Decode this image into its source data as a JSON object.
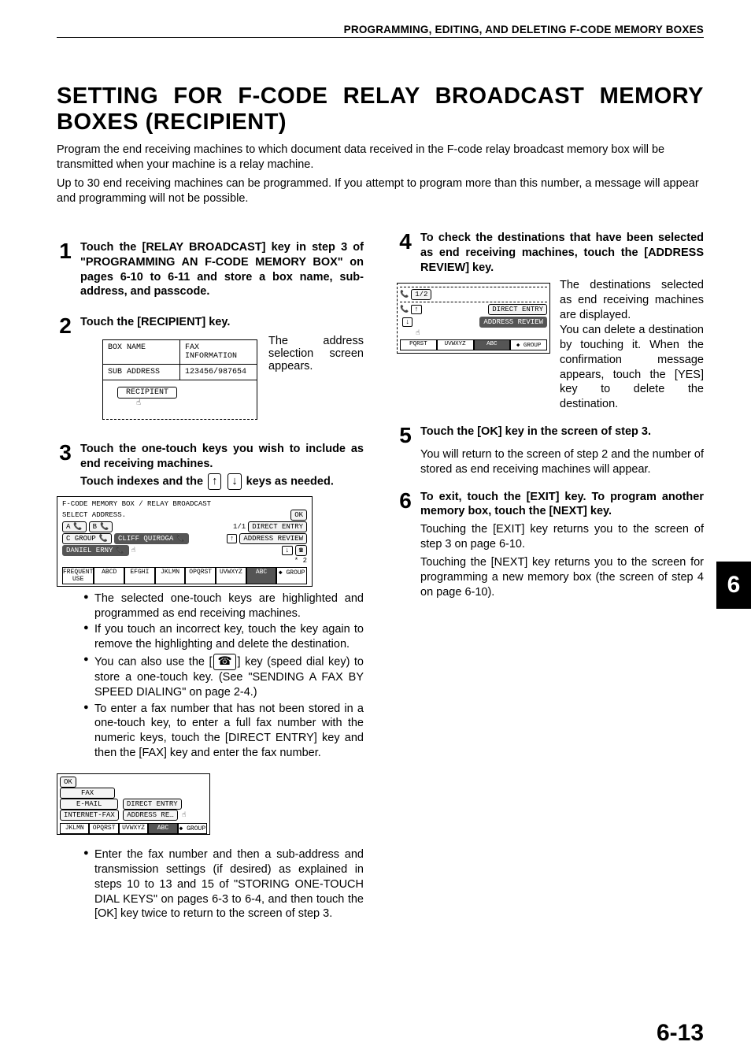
{
  "running_head": "PROGRAMMING, EDITING, AND DELETING F-CODE MEMORY BOXES",
  "title": "SETTING FOR F-CODE RELAY BROADCAST MEMORY BOXES (RECIPIENT)",
  "intro_p1": "Program the end receiving machines to which document data received in the F-code relay broadcast memory box will be transmitted when your machine is a relay machine.",
  "intro_p2": "Up to 30 end receiving machines can be programmed. If you attempt to program more than this number, a message will appear and programming will not be possible.",
  "steps": {
    "s1": {
      "num": "1",
      "head": "Touch the [RELAY BROADCAST] key in step 3 of \"PROGRAMMING AN F-CODE MEMORY BOX\" on pages 6-10 to 6-11 and store a box name, sub-address, and passcode."
    },
    "s2": {
      "num": "2",
      "head": "Touch the [RECIPIENT] key.",
      "text": "The address selection screen appears."
    },
    "s3": {
      "num": "3",
      "head_a": "Touch the one-touch keys you wish to include as end receiving machines.",
      "head_b": "Touch indexes and the  ↑  ↓  keys as needed.",
      "bullets": [
        "The selected one-touch keys are highlighted and programmed as end receiving machines.",
        "If you touch an incorrect key, touch the key again to remove the highlighting and delete the destination.",
        "You can also use the [ ☎ ] key (speed dial key) to store a one-touch key. (See \"SENDING A FAX BY SPEED DIALING\" on page 2-4.)",
        "To enter a fax number that has not been stored in a one-touch key, to enter a full fax number with the numeric keys, touch the [DIRECT ENTRY] key and then the [FAX] key and enter the fax number."
      ],
      "bullet_last": "Enter the fax number and then a sub-address and transmission settings (if desired) as explained in steps 10 to 13 and 15 of \"STORING ONE-TOUCH DIAL KEYS\" on pages 6-3 to 6-4, and then touch the [OK] key twice to return to the screen of step 3."
    },
    "s4": {
      "num": "4",
      "head": "To check the destinations that have been selected as end receiving machines, touch the [ADDRESS REVIEW] key.",
      "text_a": "The destinations selected as end receiving machines are displayed.",
      "text_b": "You can delete a destination by touching it. When the confirmation message appears, touch the [YES] key to delete the destination."
    },
    "s5": {
      "num": "5",
      "head": "Touch the [OK] key in the screen of step 3.",
      "text": "You will return to the screen of step 2 and the number of stored as end receiving machines will appear."
    },
    "s6": {
      "num": "6",
      "head": "To exit, touch the [EXIT] key. To program another memory box, touch the [NEXT] key.",
      "text_a": "Touching the [EXIT] key returns you to the screen of step 3 on page 6-10.",
      "text_b": "Touching the [NEXT] key returns you to the screen for programming a new memory box (the screen of step 4 on page 6-10)."
    }
  },
  "fig1": {
    "box_name_label": "BOX NAME",
    "fax_info_label": "FAX INFORMATION",
    "sub_addr_label": "SUB ADDRESS",
    "sub_addr_val": "123456/987654",
    "recipient_label": "RECIPIENT"
  },
  "fig3": {
    "breadcrumb": "F-CODE MEMORY BOX / RELAY BROADCAST",
    "subtitle": "SELECT ADDRESS.",
    "ok": "OK",
    "entry_a": "A",
    "entry_b": "B",
    "page": "1/1",
    "direct": "DIRECT ENTRY",
    "review": "ADDRESS REVIEW",
    "cgroup": "C GROUP",
    "cliff": "CLIFF QUIROGA",
    "daniel": "DANIEL ERNY",
    "star2": "* 2",
    "tabs": [
      "FREQUENT USE",
      "ABCD",
      "EFGHI",
      "JKLMN",
      "OPQRST",
      "UVWXYZ",
      "ABC",
      "◆ GROUP"
    ]
  },
  "fig4": {
    "page": "1/2",
    "direct": "DIRECT ENTRY",
    "review": "ADDRESS REVIEW",
    "tabs": [
      "PQRST",
      "UVWXYZ",
      "ABC",
      "◆ GROUP"
    ]
  },
  "fig5": {
    "ok": "OK",
    "fax": "FAX",
    "email": "E-MAIL",
    "ifax": "INTERNET-FAX",
    "direct": "DIRECT ENTRY",
    "review": "ADDRESS RE…",
    "tabs": [
      "JKLMN",
      "OPQRST",
      "UVWXYZ",
      "ABC",
      "◆ GROUP"
    ]
  },
  "side_tab": "6",
  "page_number": "6-13"
}
